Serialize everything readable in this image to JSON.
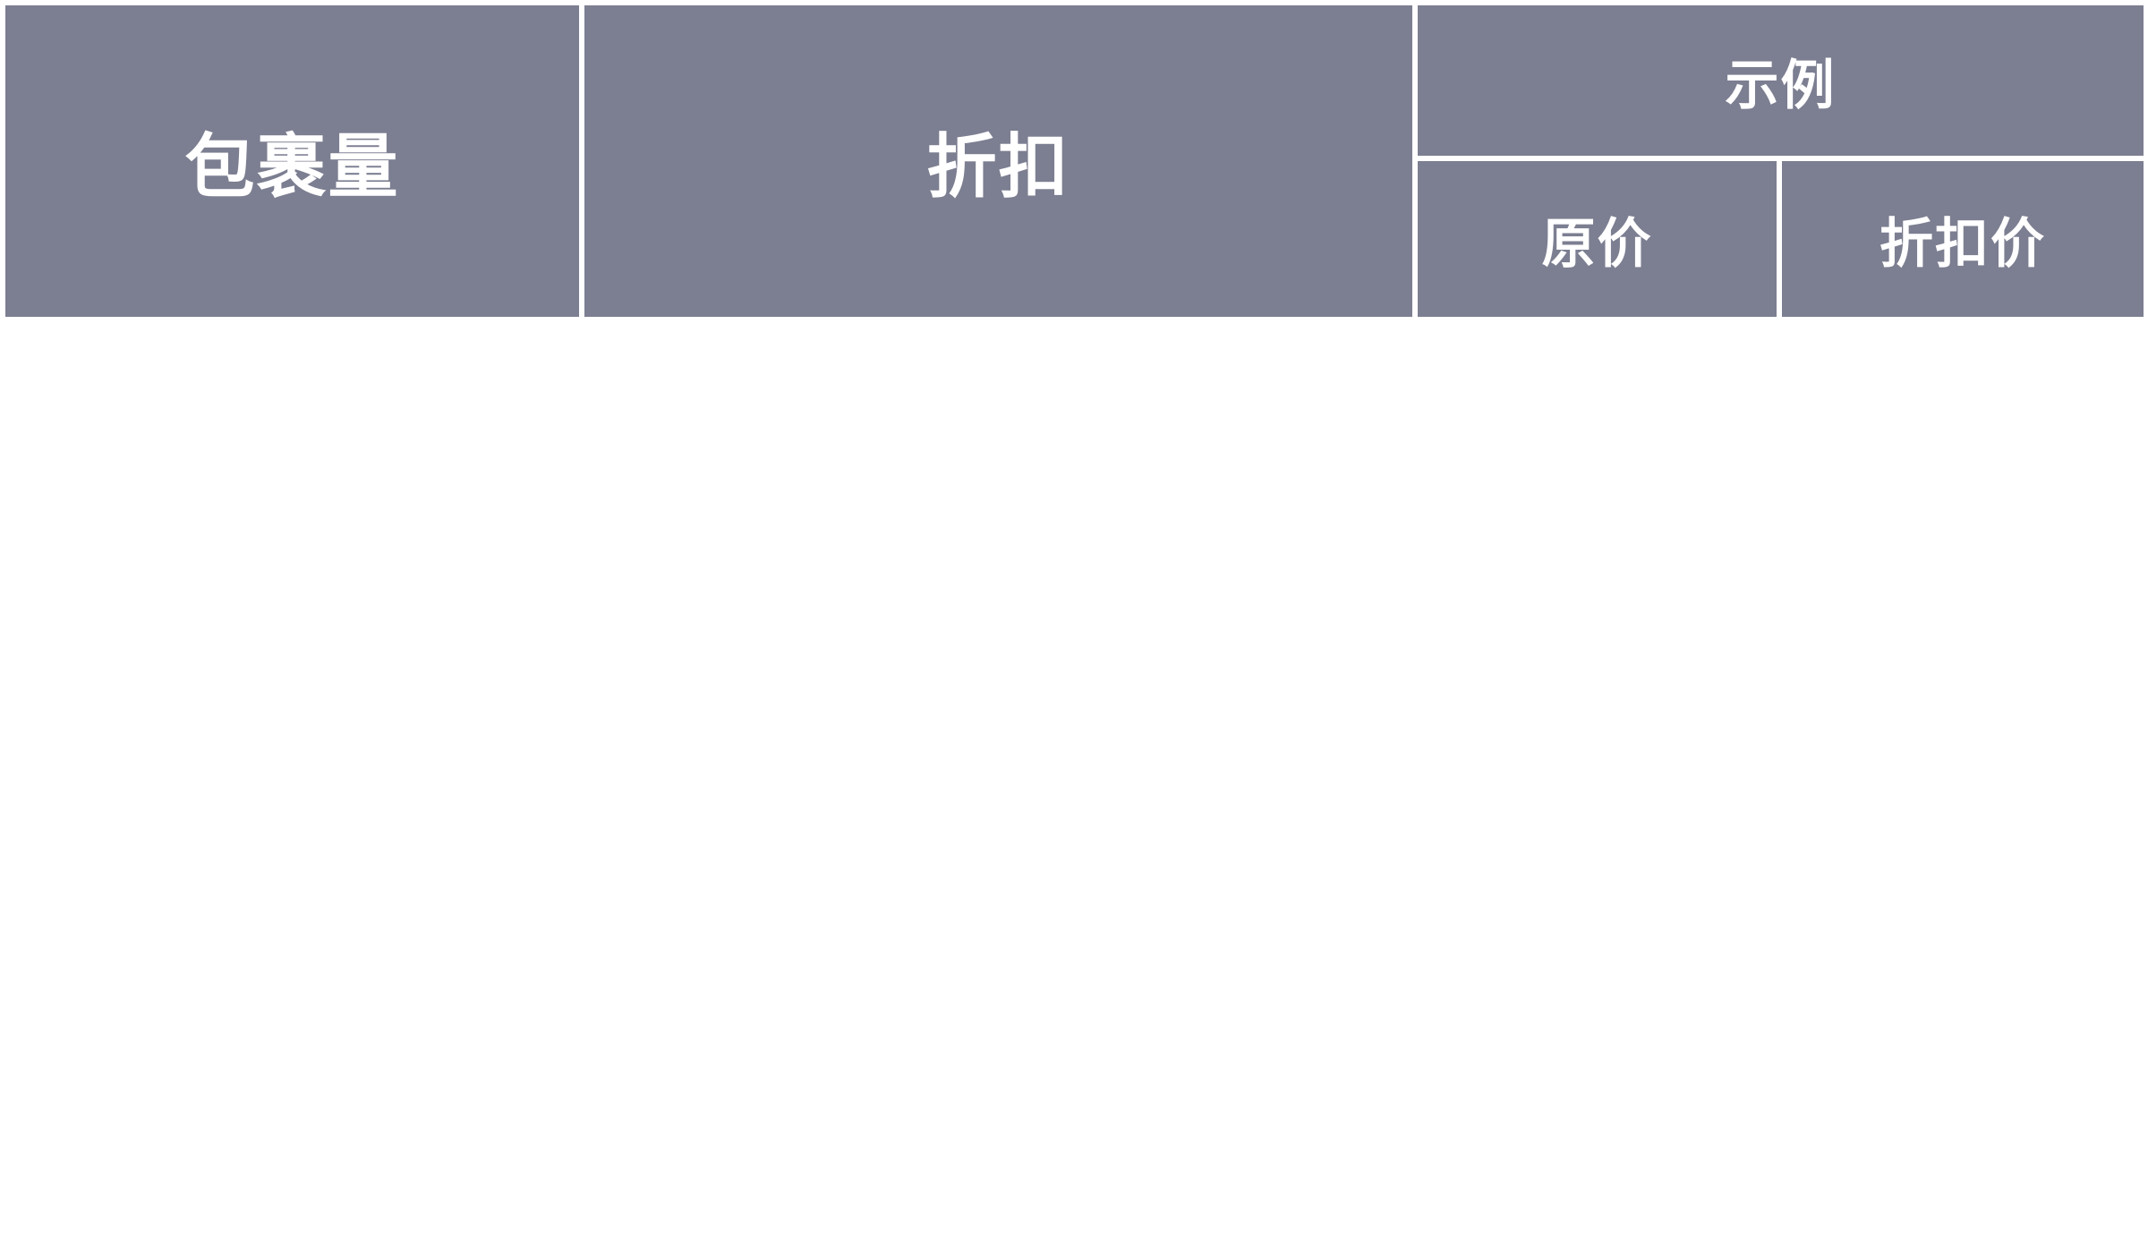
{
  "colors": {
    "header_bg": "#7c7e91",
    "header_text": "#ffffff",
    "divider": "#ffffff",
    "page_bg": "#ffffff"
  },
  "table": {
    "headers": {
      "volume": "包裹量",
      "discount": "折扣",
      "example": "示例",
      "original_price": "原价",
      "discounted_price": "折扣价"
    },
    "rows": []
  }
}
